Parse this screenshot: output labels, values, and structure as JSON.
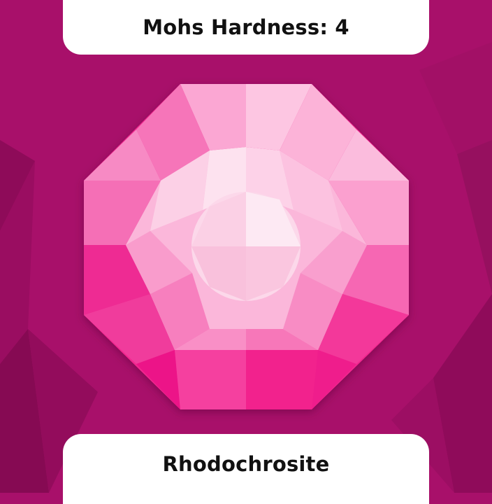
{
  "card": {
    "hardness_label": "Mohs Hardness: 4",
    "mineral_name": "Rhodochrosite"
  },
  "colors": {
    "background": "#a8106a",
    "card": "#ffffff",
    "text": "#111111",
    "gem_primary": "#f2288f"
  },
  "gem": {
    "shape": "octagon",
    "icon": "gem-icon"
  }
}
